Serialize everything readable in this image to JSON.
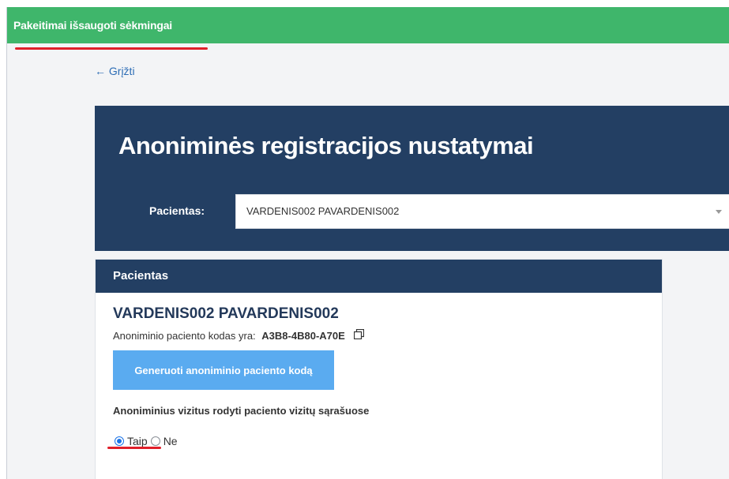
{
  "banner": {
    "message": "Pakeitimai išsaugoti sėkmingai",
    "color": "#3fb66b"
  },
  "nav": {
    "back_label": "← Grįžti"
  },
  "header": {
    "title": "Anoniminės registracijos nustatymai",
    "patient_label": "Pacientas:",
    "patient_selected": "VARDENIS002 PAVARDENIS002",
    "background_color": "#233f63"
  },
  "card": {
    "header": "Pacientas",
    "patient_name": "VARDENIS002 PAVARDENIS002",
    "code_label": "Anoniminio paciento kodas yra:",
    "code_value": "A3B8-4B80-A70E",
    "copy_icon": "copy-icon",
    "generate_button": "Generuoti anoniminio paciento kodą",
    "button_color": "#5aabf0",
    "visits_question": "Anoniminius vizitus rodyti paciento vizitų sąrašuose",
    "options": [
      {
        "label": "Taip",
        "selected": true
      },
      {
        "label": "Ne",
        "selected": false
      }
    ]
  },
  "annotations": {
    "underline_color": "#e0202a"
  }
}
